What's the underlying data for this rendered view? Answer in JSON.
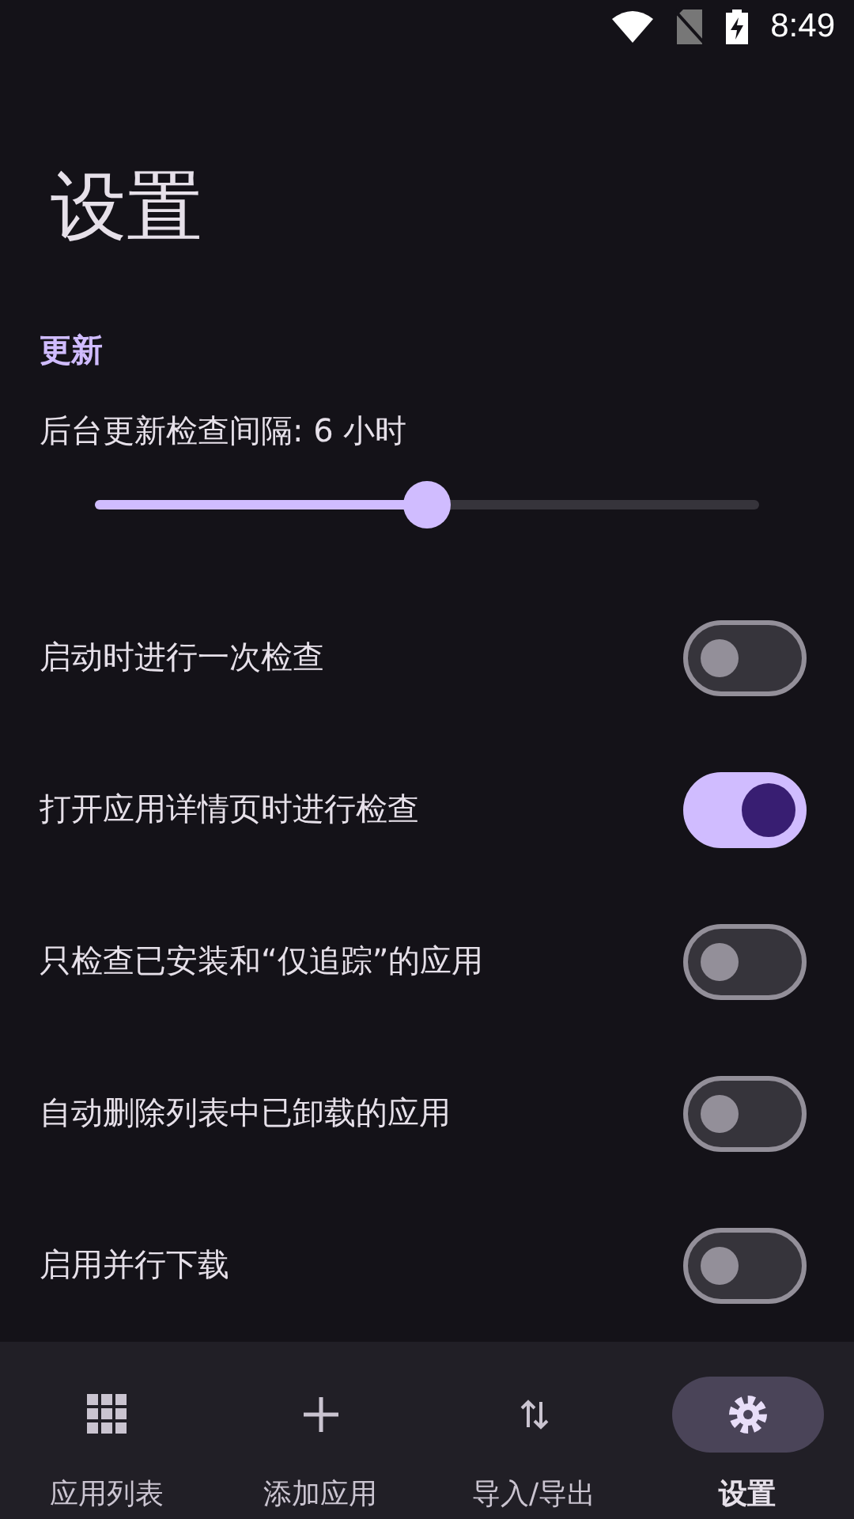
{
  "status_bar": {
    "time": "8:49"
  },
  "title": "设置",
  "section": "更新",
  "interval": {
    "label": "后台更新检查间隔: 6 小时",
    "level": 0.5
  },
  "settings": [
    {
      "label": "启动时进行一次检查",
      "on": false
    },
    {
      "label": "打开应用详情页时进行检查",
      "on": true
    },
    {
      "label": "只检查已安装和“仅追踪”的应用",
      "on": false
    },
    {
      "label": "自动删除列表中已卸载的应用",
      "on": false
    },
    {
      "label": "启用并行下载",
      "on": false
    }
  ],
  "nav": [
    {
      "label": "应用列表",
      "kind": "grid",
      "selected": false
    },
    {
      "label": "添加应用",
      "kind": "plus",
      "selected": false
    },
    {
      "label": "导入/导出",
      "kind": "transfer",
      "selected": false
    },
    {
      "label": "设置",
      "kind": "gear",
      "selected": true
    }
  ]
}
